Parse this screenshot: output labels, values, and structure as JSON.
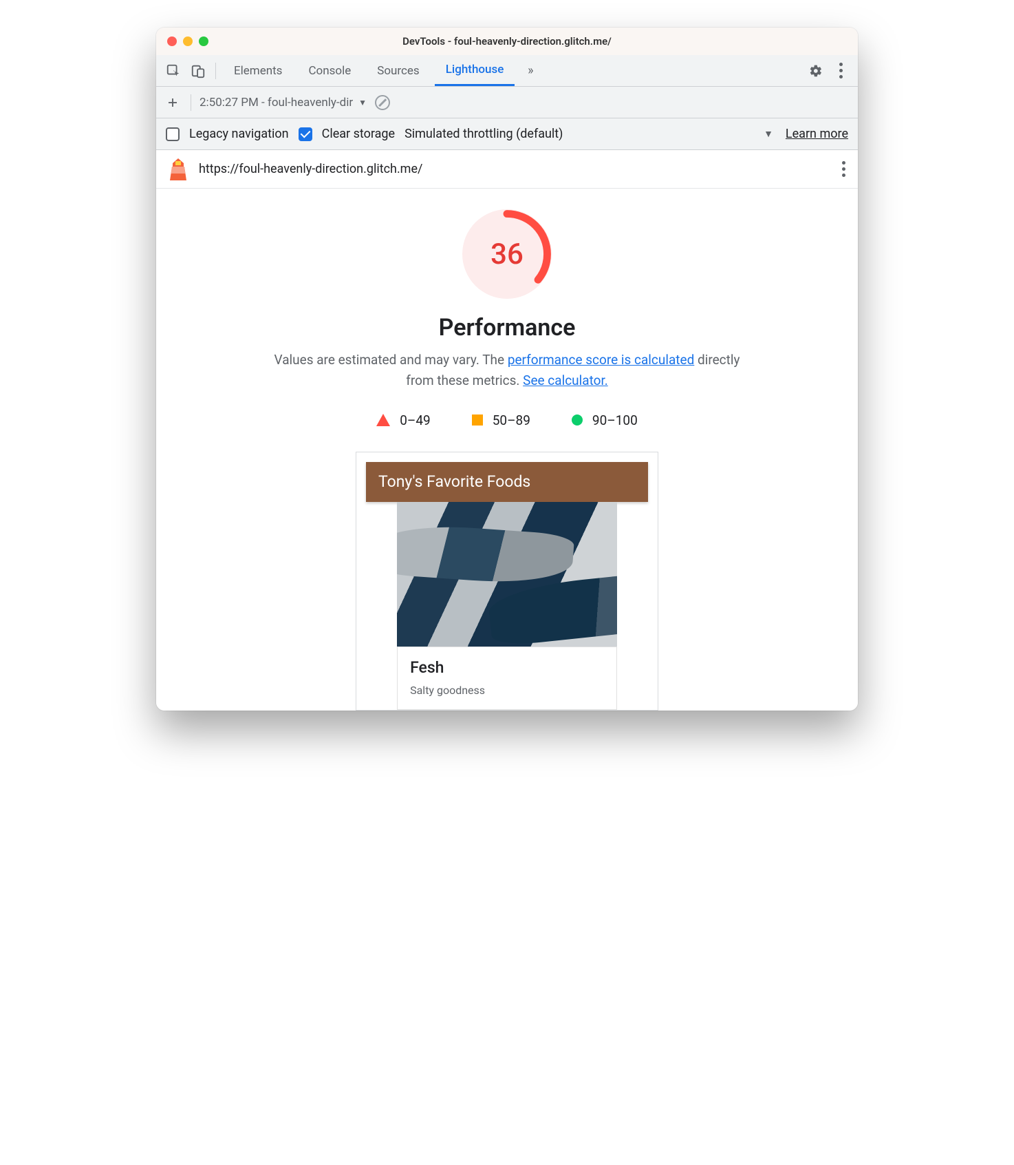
{
  "window": {
    "title": "DevTools - foul-heavenly-direction.glitch.me/"
  },
  "devtools_tabs": {
    "items": [
      "Elements",
      "Console",
      "Sources",
      "Lighthouse"
    ],
    "active": "Lighthouse"
  },
  "subbar": {
    "run_label": "2:50:27 PM - foul-heavenly-dir"
  },
  "options": {
    "legacy_label": "Legacy navigation",
    "legacy_checked": false,
    "clear_storage_label": "Clear storage",
    "clear_storage_checked": true,
    "throttling_label": "Simulated throttling (default)",
    "learn_more": "Learn more"
  },
  "report": {
    "url": "https://foul-heavenly-direction.glitch.me/",
    "score": "36",
    "score_color": "#e53a35",
    "score_percent": 36,
    "category": "Performance",
    "desc_pre": "Values are estimated and may vary. The ",
    "desc_link1": "performance score is calculated",
    "desc_mid": " directly from these metrics. ",
    "desc_link2": "See calculator.",
    "legend": {
      "fail": "0–49",
      "avg": "50–89",
      "pass": "90–100"
    }
  },
  "preview": {
    "header": "Tony's Favorite Foods",
    "card_title": "Fesh",
    "card_sub": "Salty goodness"
  }
}
